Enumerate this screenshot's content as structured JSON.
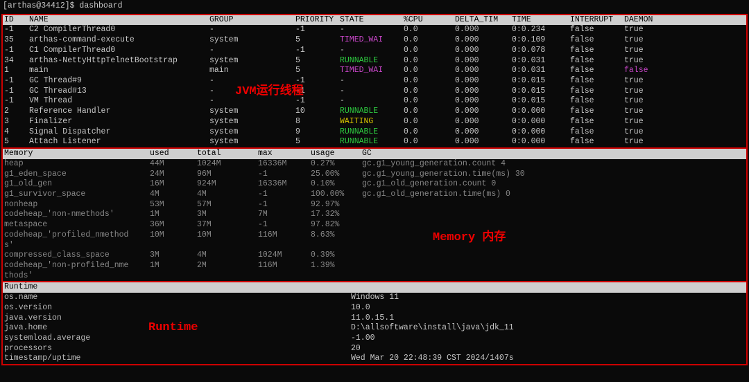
{
  "prompt": "[arthas@34412]$ dashboard",
  "threads_header": [
    "ID",
    "NAME",
    "GROUP",
    "PRIORITY",
    "STATE",
    "%CPU",
    "DELTA_TIM",
    "TIME",
    "INTERRUPT",
    "DAEMON"
  ],
  "threads": [
    {
      "id": "-1",
      "name": "C2 CompilerThread0",
      "group": "-",
      "pri": "-1",
      "state": "-",
      "cpu": "0.0",
      "delta": "0.000",
      "time": "0:0.234",
      "int": "false",
      "dae": "true"
    },
    {
      "id": "35",
      "name": "arthas-command-execute",
      "group": "system",
      "pri": "5",
      "state": "TIMED_WAI",
      "stateCls": "magenta",
      "cpu": "0.0",
      "delta": "0.000",
      "time": "0:0.109",
      "int": "false",
      "dae": "true"
    },
    {
      "id": "-1",
      "name": "C1 CompilerThread0",
      "group": "-",
      "pri": "-1",
      "state": "-",
      "cpu": "0.0",
      "delta": "0.000",
      "time": "0:0.078",
      "int": "false",
      "dae": "true"
    },
    {
      "id": "34",
      "name": "arthas-NettyHttpTelnetBootstrap",
      "group": "system",
      "pri": "5",
      "state": "RUNNABLE",
      "stateCls": "green",
      "cpu": "0.0",
      "delta": "0.000",
      "time": "0:0.031",
      "int": "false",
      "dae": "true"
    },
    {
      "id": "1",
      "name": "main",
      "group": "main",
      "pri": "5",
      "state": "TIMED_WAI",
      "stateCls": "magenta",
      "cpu": "0.0",
      "delta": "0.000",
      "time": "0:0.031",
      "int": "false",
      "dae": "false",
      "daeCls": "magenta"
    },
    {
      "id": "-1",
      "name": "GC Thread#9",
      "group": "-",
      "pri": "-1",
      "state": "-",
      "cpu": "0.0",
      "delta": "0.000",
      "time": "0:0.015",
      "int": "false",
      "dae": "true"
    },
    {
      "id": "-1",
      "name": "GC Thread#13",
      "group": "-",
      "pri": "-1",
      "state": "-",
      "cpu": "0.0",
      "delta": "0.000",
      "time": "0:0.015",
      "int": "false",
      "dae": "true"
    },
    {
      "id": "-1",
      "name": "VM Thread",
      "group": "-",
      "pri": "-1",
      "state": "-",
      "cpu": "0.0",
      "delta": "0.000",
      "time": "0:0.015",
      "int": "false",
      "dae": "true"
    },
    {
      "id": "2",
      "name": "Reference Handler",
      "group": "system",
      "pri": "10",
      "state": "RUNNABLE",
      "stateCls": "green",
      "cpu": "0.0",
      "delta": "0.000",
      "time": "0:0.000",
      "int": "false",
      "dae": "true"
    },
    {
      "id": "3",
      "name": "Finalizer",
      "group": "system",
      "pri": "8",
      "state": "WAITING",
      "stateCls": "yellow",
      "cpu": "0.0",
      "delta": "0.000",
      "time": "0:0.000",
      "int": "false",
      "dae": "true"
    },
    {
      "id": "4",
      "name": "Signal Dispatcher",
      "group": "system",
      "pri": "9",
      "state": "RUNNABLE",
      "stateCls": "green",
      "cpu": "0.0",
      "delta": "0.000",
      "time": "0:0.000",
      "int": "false",
      "dae": "true"
    },
    {
      "id": "5",
      "name": "Attach Listener",
      "group": "system",
      "pri": "5",
      "state": "RUNNABLE",
      "stateCls": "green",
      "cpu": "0.0",
      "delta": "0.000",
      "time": "0:0.000",
      "int": "false",
      "dae": "true"
    }
  ],
  "mem_header": [
    "Memory",
    "used",
    "total",
    "max",
    "usage",
    "GC"
  ],
  "mem_rows": [
    {
      "name": "heap",
      "used": "44M",
      "total": "1024M",
      "max": "16336M",
      "usage": "0.27%",
      "gc": "gc.g1_young_generation.count    4"
    },
    {
      "name": "g1_eden_space",
      "used": "24M",
      "total": "96M",
      "max": "-1",
      "usage": "25.00%",
      "gc": "gc.g1_young_generation.time(ms) 30"
    },
    {
      "name": "g1_old_gen",
      "used": "16M",
      "total": "924M",
      "max": "16336M",
      "usage": "0.10%",
      "gc": "gc.g1_old_generation.count      0"
    },
    {
      "name": "g1_survivor_space",
      "used": "4M",
      "total": "4M",
      "max": "-1",
      "usage": "100.00%",
      "gc": "gc.g1_old_generation.time(ms)   0"
    },
    {
      "name": "nonheap",
      "used": "53M",
      "total": "57M",
      "max": "-1",
      "usage": "92.97%",
      "gc": ""
    },
    {
      "name": "codeheap_'non-nmethods'",
      "used": "1M",
      "total": "3M",
      "max": "7M",
      "usage": "17.32%",
      "gc": ""
    },
    {
      "name": "metaspace",
      "used": "36M",
      "total": "37M",
      "max": "-1",
      "usage": "97.82%",
      "gc": ""
    },
    {
      "name": "codeheap_'profiled_nmethod",
      "used": "10M",
      "total": "10M",
      "max": "116M",
      "usage": "8.63%",
      "gc": ""
    },
    {
      "name": "s'",
      "used": "",
      "total": "",
      "max": "",
      "usage": "",
      "gc": ""
    },
    {
      "name": "compressed_class_space",
      "used": "3M",
      "total": "4M",
      "max": "1024M",
      "usage": "0.39%",
      "gc": ""
    },
    {
      "name": "codeheap_'non-profiled_nme",
      "used": "1M",
      "total": "2M",
      "max": "116M",
      "usage": "1.39%",
      "gc": ""
    },
    {
      "name": "thods'",
      "used": "",
      "total": "",
      "max": "",
      "usage": "",
      "gc": ""
    }
  ],
  "runtime_header": "Runtime",
  "runtime_rows": [
    {
      "k": "os.name",
      "v": "Windows 11"
    },
    {
      "k": "os.version",
      "v": "10.0"
    },
    {
      "k": "java.version",
      "v": "11.0.15.1"
    },
    {
      "k": "java.home",
      "v": "D:\\allsoftware\\install\\java\\jdk_11"
    },
    {
      "k": "systemload.average",
      "v": "-1.00"
    },
    {
      "k": "processors",
      "v": "20"
    },
    {
      "k": "timestamp/uptime",
      "v": "Wed Mar 20 22:48:39 CST 2024/1407s"
    }
  ],
  "overlays": {
    "threads": "JVM运行线程",
    "memory": "Memory 内存",
    "runtime": "Runtime"
  }
}
